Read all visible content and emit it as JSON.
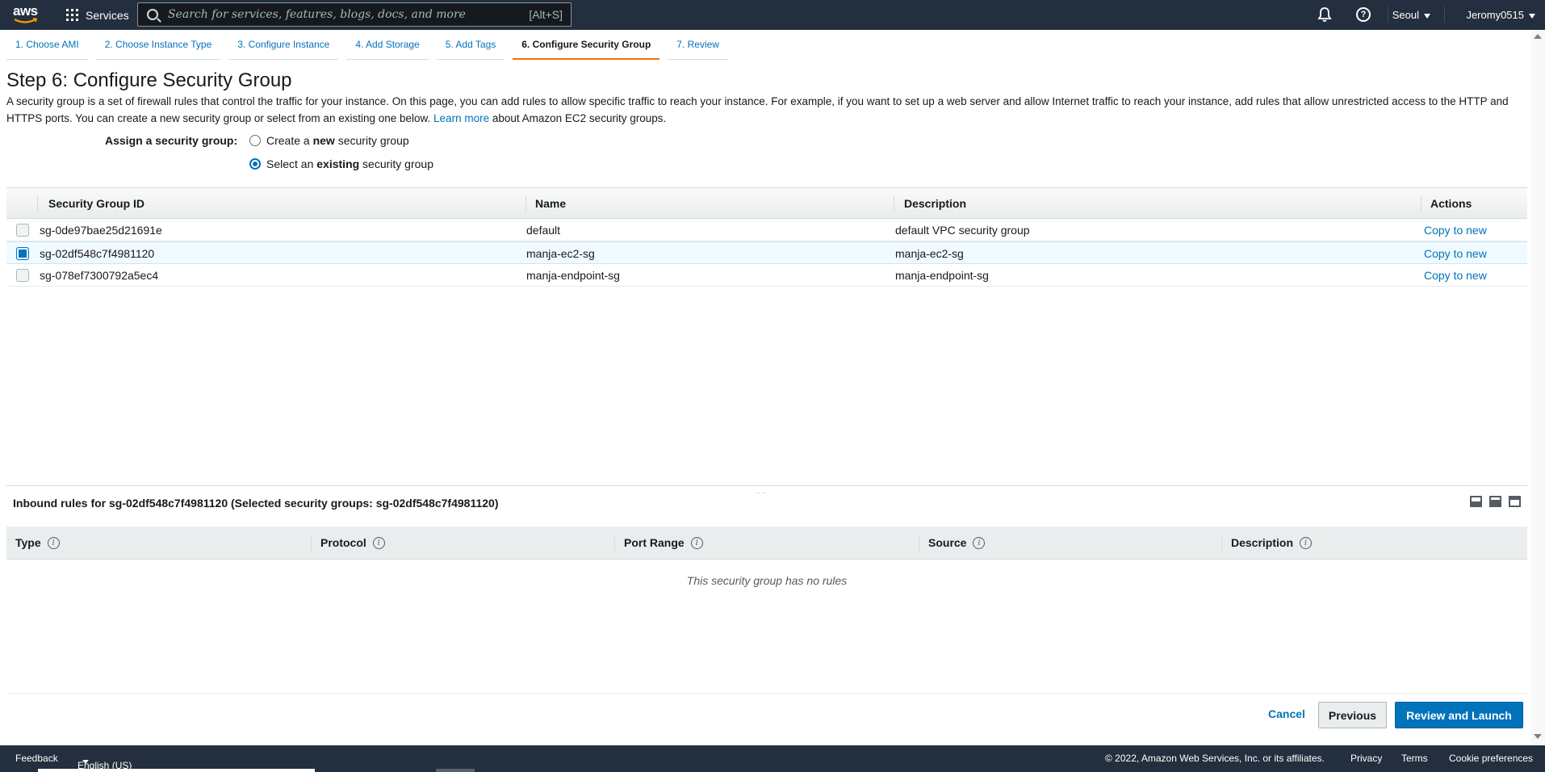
{
  "topnav": {
    "logo_text": "aws",
    "services_label": "Services",
    "search_placeholder": "Search for services, features, blogs, docs, and more",
    "search_shortcut": "[Alt+S]",
    "region": "Seoul",
    "user": "Jeromy0515"
  },
  "steps": [
    {
      "label": "1. Choose AMI"
    },
    {
      "label": "2. Choose Instance Type"
    },
    {
      "label": "3. Configure Instance"
    },
    {
      "label": "4. Add Storage"
    },
    {
      "label": "5. Add Tags"
    },
    {
      "label": "6. Configure Security Group",
      "active": true
    },
    {
      "label": "7. Review"
    }
  ],
  "page": {
    "title": "Step 6: Configure Security Group",
    "intro_part1": "A security group is a set of firewall rules that control the traffic for your instance. On this page, you can add rules to allow specific traffic to reach your instance. For example, if you want to set up a web server and allow Internet traffic to reach your instance, add rules that allow unrestricted access to the HTTP and HTTPS ports. You can create a new security group or select from an existing one below.",
    "learn_more": "Learn more",
    "intro_part2": "about Amazon EC2 security groups."
  },
  "assign": {
    "label": "Assign a security group:",
    "option_new_pre": "Create a ",
    "option_new_bold": "new",
    "option_new_post": " security group",
    "option_existing_pre": "Select an ",
    "option_existing_bold": "existing",
    "option_existing_post": " security group",
    "selected": "existing"
  },
  "sg_table": {
    "headers": {
      "id": "Security Group ID",
      "name": "Name",
      "description": "Description",
      "actions": "Actions"
    },
    "rows": [
      {
        "id": "sg-0de97bae25d21691e",
        "name": "default",
        "description": "default VPC security group",
        "action": "Copy to new",
        "selected": false
      },
      {
        "id": "sg-02df548c7f4981120",
        "name": "manja-ec2-sg",
        "description": "manja-ec2-sg",
        "action": "Copy to new",
        "selected": true
      },
      {
        "id": "sg-078ef7300792a5ec4",
        "name": "manja-endpoint-sg",
        "description": "manja-endpoint-sg",
        "action": "Copy to new",
        "selected": false
      }
    ]
  },
  "inbound": {
    "title": "Inbound rules for sg-02df548c7f4981120 (Selected security groups: sg-02df548c7f4981120)",
    "headers": {
      "type": "Type",
      "protocol": "Protocol",
      "port_range": "Port Range",
      "source": "Source",
      "description": "Description"
    },
    "empty_message": "This security group has no rules"
  },
  "actions": {
    "cancel": "Cancel",
    "previous": "Previous",
    "review_launch": "Review and Launch"
  },
  "bottombar": {
    "feedback": "Feedback",
    "language": "English (US)",
    "copyright": "© 2022, Amazon Web Services, Inc. or its affiliates.",
    "privacy": "Privacy",
    "terms": "Terms",
    "cookie": "Cookie preferences"
  },
  "colors": {
    "nav_bg": "#232f3e",
    "link": "#0073bb",
    "accent": "#ec7211",
    "primary_button": "#0073bb"
  }
}
